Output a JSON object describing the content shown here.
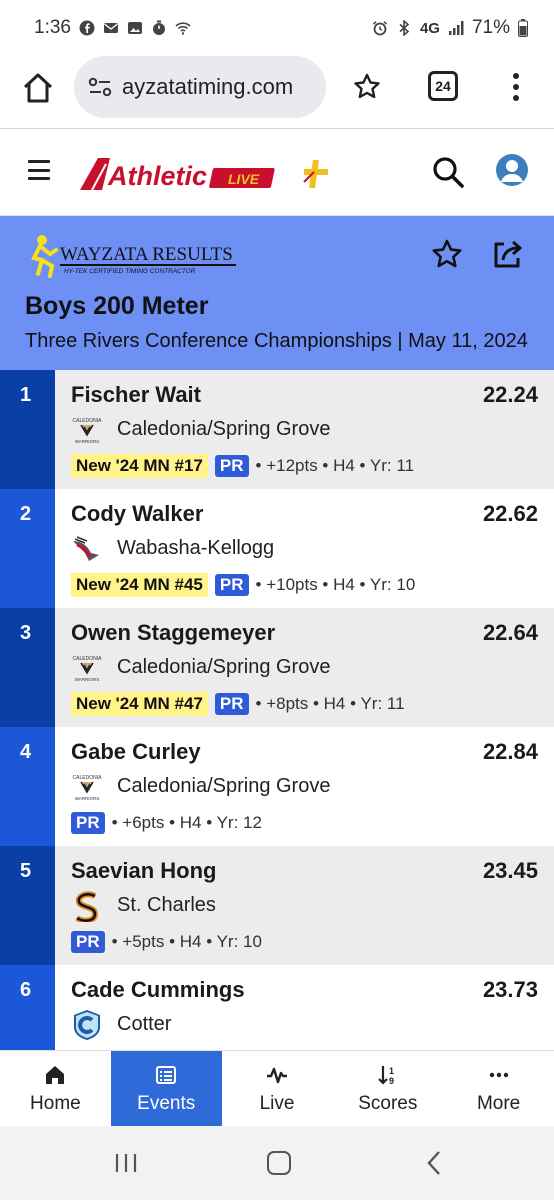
{
  "status_bar": {
    "time": "1:36",
    "network": "4G",
    "battery": "71%"
  },
  "browser": {
    "url": "ayzatatiming.com",
    "tab_count": "24"
  },
  "app": {
    "logo_text": "Athletic",
    "logo_badge": "LIVE",
    "brand_red": "#c8102e",
    "accent_yellow": "#f2c01e"
  },
  "event": {
    "host_logo_title": "WAYZATA RESULTS",
    "host_logo_subtitle": "HY-TEK CERTIFIED TIMING CONTRACTOR",
    "title": "Boys 200 Meter",
    "meet": "Three Rivers Conference Championships | May 11, 2024"
  },
  "results": [
    {
      "place": "1",
      "name": "Fischer Wait",
      "time": "22.24",
      "team": "Caledonia/Spring Grove",
      "team_logo": "caledonia-warriors-logo",
      "rank": "New '24 MN #17",
      "pr": "PR",
      "detail": "• +12pts • H4 • Yr: 11",
      "place_color": "#0b3fa8"
    },
    {
      "place": "2",
      "name": "Cody Walker",
      "time": "22.62",
      "team": "Wabasha-Kellogg",
      "team_logo": "wabasha-kellogg-falcon-logo",
      "rank": "New '24 MN #45",
      "pr": "PR",
      "detail": "• +10pts • H4 • Yr: 10",
      "place_color": "#1b57d6"
    },
    {
      "place": "3",
      "name": "Owen Staggemeyer",
      "time": "22.64",
      "team": "Caledonia/Spring Grove",
      "team_logo": "caledonia-warriors-logo",
      "rank": "New '24 MN #47",
      "pr": "PR",
      "detail": "• +8pts • H4 • Yr: 11",
      "place_color": "#0b3fa8"
    },
    {
      "place": "4",
      "name": "Gabe Curley",
      "time": "22.84",
      "team": "Caledonia/Spring Grove",
      "team_logo": "caledonia-warriors-logo",
      "rank": "",
      "pr": "PR",
      "detail": "• +6pts • H4 • Yr: 12",
      "place_color": "#1b57d6"
    },
    {
      "place": "5",
      "name": "Saevian Hong",
      "time": "23.45",
      "team": "St. Charles",
      "team_logo": "st-charles-saints-logo",
      "rank": "",
      "pr": "PR",
      "detail": "• +5pts • H4 • Yr: 10",
      "place_color": "#0b3fa8"
    },
    {
      "place": "6",
      "name": "Cade Cummings",
      "time": "23.73",
      "team": "Cotter",
      "team_logo": "cotter-c-logo",
      "rank": "",
      "pr": "",
      "detail": "",
      "place_color": "#1b57d6"
    }
  ],
  "bottom_nav": [
    {
      "label": "Home",
      "icon": "home-icon",
      "active": false
    },
    {
      "label": "Events",
      "icon": "list-icon",
      "active": true
    },
    {
      "label": "Live",
      "icon": "pulse-icon",
      "active": false
    },
    {
      "label": "Scores",
      "icon": "sort-icon",
      "active": false
    },
    {
      "label": "More",
      "icon": "more-icon",
      "active": false
    }
  ]
}
